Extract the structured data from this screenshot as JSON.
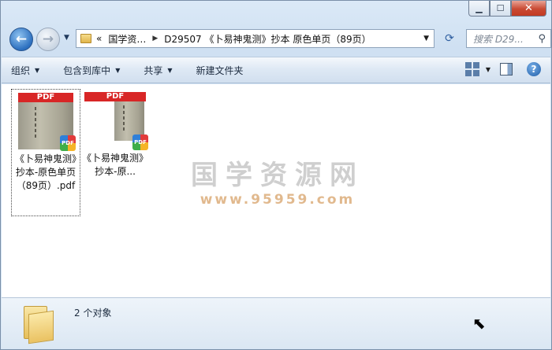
{
  "window": {
    "minimize": "▁",
    "maximize": "☐",
    "close": "✕"
  },
  "nav": {
    "back_icon": "arrow-left-icon",
    "forward_icon": "arrow-right-icon",
    "address_chevron": "«",
    "breadcrumb_1": "国学资…",
    "breadcrumb_2": "D29507 《卜易神鬼测》抄本 原色单页（89页）",
    "refresh_icon": "⟳",
    "search_placeholder": "搜索 D29..."
  },
  "toolbar": {
    "organize": "组织",
    "include_library": "包含到库中",
    "share": "共享",
    "new_folder": "新建文件夹"
  },
  "files": [
    {
      "name": "《卜易神鬼测》抄本-原色单页（89页）.pdf",
      "badge": "PDF",
      "selected": true
    },
    {
      "name": "《卜易神鬼测》抄本-原...",
      "badge": "PDF",
      "selected": false
    }
  ],
  "watermark": {
    "main": "国学资源网",
    "sub": "www.95959.com"
  },
  "status": {
    "count_text": "2 个对象"
  }
}
